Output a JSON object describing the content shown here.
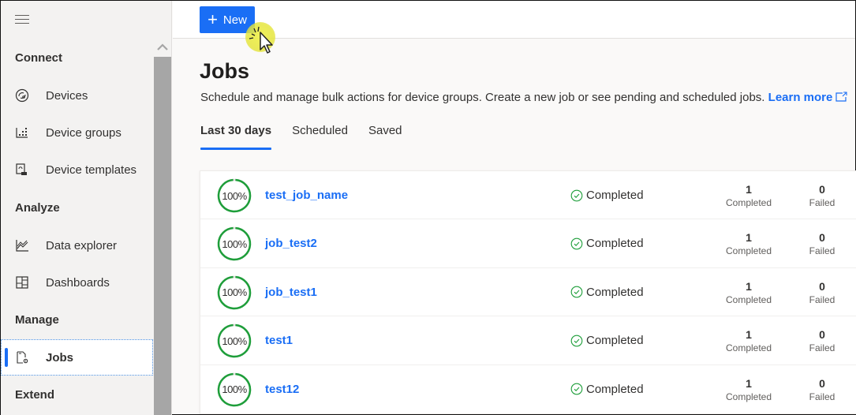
{
  "sidebar": {
    "sections": [
      {
        "title": "Connect",
        "items": [
          {
            "label": "Devices",
            "icon": "devices-icon"
          },
          {
            "label": "Device groups",
            "icon": "device-groups-icon"
          },
          {
            "label": "Device templates",
            "icon": "device-templates-icon"
          }
        ]
      },
      {
        "title": "Analyze",
        "items": [
          {
            "label": "Data explorer",
            "icon": "data-explorer-icon"
          },
          {
            "label": "Dashboards",
            "icon": "dashboards-icon"
          }
        ]
      },
      {
        "title": "Manage",
        "items": [
          {
            "label": "Jobs",
            "icon": "jobs-icon",
            "active": true
          }
        ]
      },
      {
        "title": "Extend",
        "items": []
      }
    ]
  },
  "toolbar": {
    "new_label": "New"
  },
  "page": {
    "title": "Jobs",
    "description": "Schedule and manage bulk actions for device groups. Create a new job or see pending and scheduled jobs.",
    "learn_more": "Learn more"
  },
  "tabs": [
    {
      "label": "Last 30 days",
      "active": true
    },
    {
      "label": "Scheduled"
    },
    {
      "label": "Saved"
    }
  ],
  "colors": {
    "accent": "#1a6ef5",
    "success": "#1e9e3a"
  },
  "jobs": [
    {
      "progress": "100%",
      "progress_value": 1.0,
      "name": "test_job_name",
      "status": "Completed",
      "completed_count": "1",
      "completed_label": "Completed",
      "failed_count": "0",
      "failed_label": "Failed"
    },
    {
      "progress": "100%",
      "progress_value": 1.0,
      "name": "job_test2",
      "status": "Completed",
      "completed_count": "1",
      "completed_label": "Completed",
      "failed_count": "0",
      "failed_label": "Failed"
    },
    {
      "progress": "100%",
      "progress_value": 1.0,
      "name": "job_test1",
      "status": "Completed",
      "completed_count": "1",
      "completed_label": "Completed",
      "failed_count": "0",
      "failed_label": "Failed"
    },
    {
      "progress": "100%",
      "progress_value": 1.0,
      "name": "test1",
      "status": "Completed",
      "completed_count": "1",
      "completed_label": "Completed",
      "failed_count": "0",
      "failed_label": "Failed"
    },
    {
      "progress": "100%",
      "progress_value": 1.0,
      "name": "test12",
      "status": "Completed",
      "completed_count": "1",
      "completed_label": "Completed",
      "failed_count": "0",
      "failed_label": "Failed"
    }
  ]
}
